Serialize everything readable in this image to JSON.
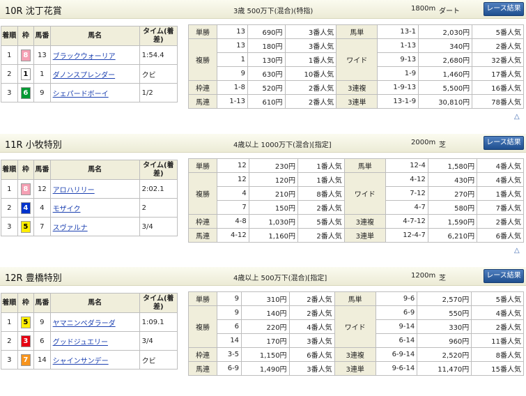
{
  "button_label": "レース結果",
  "finish_headers": [
    "着順",
    "枠",
    "馬番",
    "馬名",
    "タイム(着差)"
  ],
  "races": [
    {
      "title": "10R 沈丁花賞",
      "conditions": "3歳 500万下(混合)(特指)",
      "distance": "1800m",
      "surface": "ダート",
      "finish": [
        {
          "pos": "1",
          "waku": "8",
          "num": "13",
          "name": "ブラックウォーリア",
          "time": "1:54.4"
        },
        {
          "pos": "2",
          "waku": "1",
          "num": "1",
          "name": "ダノンスプレンダー",
          "time": "クビ"
        },
        {
          "pos": "3",
          "waku": "6",
          "num": "9",
          "name": "シェパードボーイ",
          "time": "1/2"
        }
      ],
      "payouts": {
        "tansho": {
          "label": "単勝",
          "rows": [
            [
              "13",
              "690円",
              "3番人気"
            ]
          ]
        },
        "fukusho": {
          "label": "複勝",
          "rows": [
            [
              "13",
              "180円",
              "3番人気"
            ],
            [
              "1",
              "130円",
              "1番人気"
            ],
            [
              "9",
              "630円",
              "10番人気"
            ]
          ]
        },
        "wakuren": {
          "label": "枠連",
          "rows": [
            [
              "1-8",
              "520円",
              "2番人気"
            ]
          ]
        },
        "umaren": {
          "label": "馬連",
          "rows": [
            [
              "1-13",
              "610円",
              "2番人気"
            ]
          ]
        },
        "umatan": {
          "label": "馬単",
          "rows": [
            [
              "13-1",
              "2,030円",
              "5番人気"
            ]
          ]
        },
        "wide": {
          "label": "ワイド",
          "rows": [
            [
              "1-13",
              "340円",
              "2番人気"
            ],
            [
              "9-13",
              "2,680円",
              "32番人気"
            ],
            [
              "1-9",
              "1,460円",
              "17番人気"
            ]
          ]
        },
        "sanrenpuku": {
          "label": "3連複",
          "rows": [
            [
              "1-9-13",
              "5,500円",
              "16番人気"
            ]
          ]
        },
        "sanrentan": {
          "label": "3連単",
          "rows": [
            [
              "13-1-9",
              "30,810円",
              "78番人気"
            ]
          ]
        }
      }
    },
    {
      "title": "11R 小牧特別",
      "conditions": "4歳以上 1000万下(混合)[指定]",
      "distance": "2000m",
      "surface": "芝",
      "finish": [
        {
          "pos": "1",
          "waku": "8",
          "num": "12",
          "name": "アロハリリー",
          "time": "2:02.1"
        },
        {
          "pos": "2",
          "waku": "4",
          "num": "4",
          "name": "モザイク",
          "time": "2"
        },
        {
          "pos": "3",
          "waku": "5",
          "num": "7",
          "name": "スヴァルナ",
          "time": "3/4"
        }
      ],
      "payouts": {
        "tansho": {
          "label": "単勝",
          "rows": [
            [
              "12",
              "230円",
              "1番人気"
            ]
          ]
        },
        "fukusho": {
          "label": "複勝",
          "rows": [
            [
              "12",
              "120円",
              "1番人気"
            ],
            [
              "4",
              "210円",
              "8番人気"
            ],
            [
              "7",
              "150円",
              "2番人気"
            ]
          ]
        },
        "wakuren": {
          "label": "枠連",
          "rows": [
            [
              "4-8",
              "1,030円",
              "5番人気"
            ]
          ]
        },
        "umaren": {
          "label": "馬連",
          "rows": [
            [
              "4-12",
              "1,160円",
              "2番人気"
            ]
          ]
        },
        "umatan": {
          "label": "馬単",
          "rows": [
            [
              "12-4",
              "1,580円",
              "4番人気"
            ]
          ]
        },
        "wide": {
          "label": "ワイド",
          "rows": [
            [
              "4-12",
              "430円",
              "4番人気"
            ],
            [
              "7-12",
              "270円",
              "1番人気"
            ],
            [
              "4-7",
              "580円",
              "7番人気"
            ]
          ]
        },
        "sanrenpuku": {
          "label": "3連複",
          "rows": [
            [
              "4-7-12",
              "1,590円",
              "2番人気"
            ]
          ]
        },
        "sanrentan": {
          "label": "3連単",
          "rows": [
            [
              "12-4-7",
              "6,210円",
              "6番人気"
            ]
          ]
        }
      }
    },
    {
      "title": "12R 豊橋特別",
      "conditions": "4歳以上 500万下(混合)[指定]",
      "distance": "1200m",
      "surface": "芝",
      "finish": [
        {
          "pos": "1",
          "waku": "5",
          "num": "9",
          "name": "ヤマニンペダラーダ",
          "time": "1:09.1"
        },
        {
          "pos": "2",
          "waku": "3",
          "num": "6",
          "name": "グッドジュエリー",
          "time": "3/4"
        },
        {
          "pos": "3",
          "waku": "7",
          "num": "14",
          "name": "シャインサンデー",
          "time": "クビ"
        }
      ],
      "payouts": {
        "tansho": {
          "label": "単勝",
          "rows": [
            [
              "9",
              "310円",
              "2番人気"
            ]
          ]
        },
        "fukusho": {
          "label": "複勝",
          "rows": [
            [
              "9",
              "140円",
              "2番人気"
            ],
            [
              "6",
              "220円",
              "4番人気"
            ],
            [
              "14",
              "170円",
              "3番人気"
            ]
          ]
        },
        "wakuren": {
          "label": "枠連",
          "rows": [
            [
              "3-5",
              "1,150円",
              "6番人気"
            ]
          ]
        },
        "umaren": {
          "label": "馬連",
          "rows": [
            [
              "6-9",
              "1,490円",
              "3番人気"
            ]
          ]
        },
        "umatan": {
          "label": "馬単",
          "rows": [
            [
              "9-6",
              "2,570円",
              "5番人気"
            ]
          ]
        },
        "wide": {
          "label": "ワイド",
          "rows": [
            [
              "6-9",
              "550円",
              "4番人気"
            ],
            [
              "9-14",
              "330円",
              "2番人気"
            ],
            [
              "6-14",
              "960円",
              "11番人気"
            ]
          ]
        },
        "sanrenpuku": {
          "label": "3連複",
          "rows": [
            [
              "6-9-14",
              "2,520円",
              "8番人気"
            ]
          ]
        },
        "sanrentan": {
          "label": "3連単",
          "rows": [
            [
              "9-6-14",
              "11,470円",
              "15番人気"
            ]
          ]
        }
      }
    }
  ],
  "waku_colors": {
    "1": {
      "bg": "#ffffff",
      "fg": "#000000"
    },
    "2": {
      "bg": "#000000",
      "fg": "#ffffff"
    },
    "3": {
      "bg": "#e60012",
      "fg": "#ffffff"
    },
    "4": {
      "bg": "#0033cc",
      "fg": "#ffffff"
    },
    "5": {
      "bg": "#ffee00",
      "fg": "#000000"
    },
    "6": {
      "bg": "#009933",
      "fg": "#ffffff"
    },
    "7": {
      "bg": "#f7941d",
      "fg": "#ffffff"
    },
    "8": {
      "bg": "#f5a0b4",
      "fg": "#ffffff"
    }
  },
  "up_icon": "up-triangle-icon"
}
